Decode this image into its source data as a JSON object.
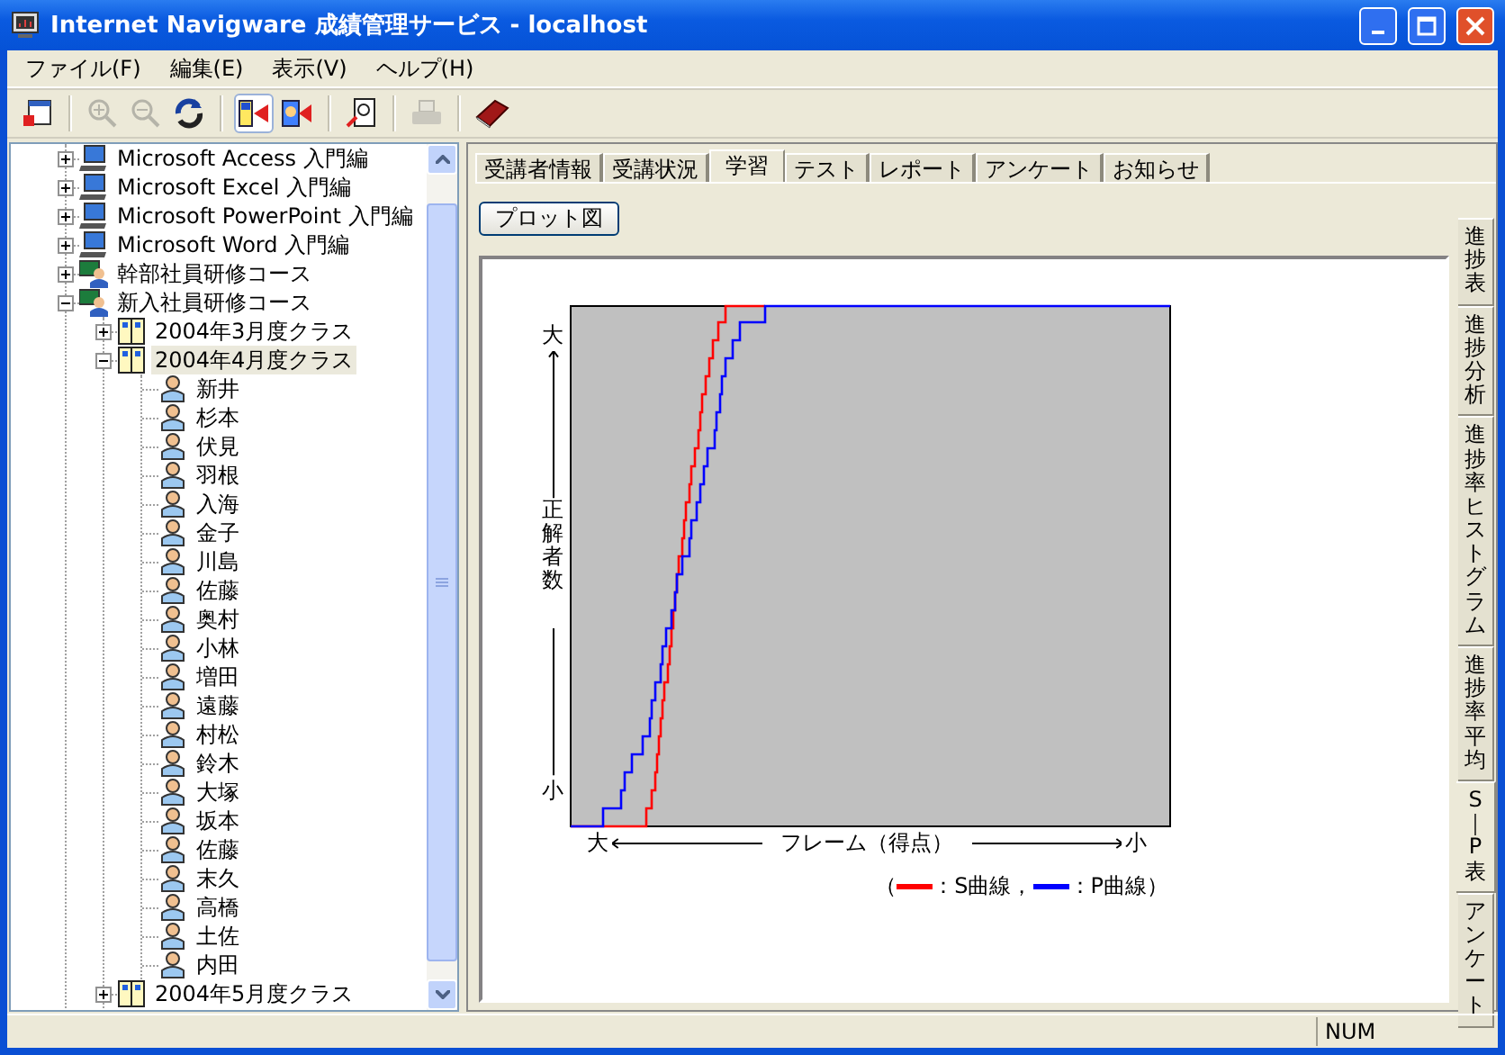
{
  "window": {
    "title": "Internet Navigware 成績管理サービス - localhost"
  },
  "menu": [
    "ファイル(F)",
    "編集(E)",
    "表示(V)",
    "ヘルプ(H)"
  ],
  "toolbar": [
    {
      "kind": "window",
      "disabled": false,
      "pressed": false
    },
    {
      "kind": "separator"
    },
    {
      "kind": "zoom-in",
      "disabled": true,
      "pressed": false
    },
    {
      "kind": "zoom-out",
      "disabled": true,
      "pressed": false
    },
    {
      "kind": "refresh",
      "disabled": false,
      "pressed": false
    },
    {
      "kind": "separator"
    },
    {
      "kind": "panel-left",
      "disabled": false,
      "pressed": true
    },
    {
      "kind": "panel-right",
      "disabled": false,
      "pressed": false
    },
    {
      "kind": "separator"
    },
    {
      "kind": "report",
      "disabled": false,
      "pressed": false
    },
    {
      "kind": "separator"
    },
    {
      "kind": "printer",
      "disabled": true,
      "pressed": false
    },
    {
      "kind": "separator"
    },
    {
      "kind": "book",
      "disabled": false,
      "pressed": false
    }
  ],
  "tree": [
    {
      "kind": "computer",
      "label": "Microsoft Access 入門編",
      "expanded": false,
      "selected": false
    },
    {
      "kind": "computer",
      "label": "Microsoft Excel 入門編",
      "expanded": false,
      "selected": false
    },
    {
      "kind": "computer",
      "label": "Microsoft PowerPoint 入門編",
      "expanded": false,
      "selected": false
    },
    {
      "kind": "computer",
      "label": "Microsoft Word 入門編",
      "expanded": false,
      "selected": false
    },
    {
      "kind": "course",
      "label": "幹部社員研修コース",
      "expanded": false,
      "selected": false
    },
    {
      "kind": "course",
      "label": "新入社員研修コース",
      "expanded": true,
      "selected": false,
      "children": [
        {
          "kind": "class",
          "label": "2004年3月度クラス",
          "expanded": false,
          "selected": false
        },
        {
          "kind": "class",
          "label": "2004年4月度クラス",
          "expanded": true,
          "selected": true,
          "children": [
            {
              "kind": "person",
              "label": "新井",
              "selected": false
            },
            {
              "kind": "person",
              "label": "杉本",
              "selected": false
            },
            {
              "kind": "person",
              "label": "伏見",
              "selected": false
            },
            {
              "kind": "person",
              "label": "羽根",
              "selected": false
            },
            {
              "kind": "person",
              "label": "入海",
              "selected": false
            },
            {
              "kind": "person",
              "label": "金子",
              "selected": false
            },
            {
              "kind": "person",
              "label": "川島",
              "selected": false
            },
            {
              "kind": "person",
              "label": "佐藤",
              "selected": false
            },
            {
              "kind": "person",
              "label": "奥村",
              "selected": false
            },
            {
              "kind": "person",
              "label": "小林",
              "selected": false
            },
            {
              "kind": "person",
              "label": "増田",
              "selected": false
            },
            {
              "kind": "person",
              "label": "遠藤",
              "selected": false
            },
            {
              "kind": "person",
              "label": "村松",
              "selected": false
            },
            {
              "kind": "person",
              "label": "鈴木",
              "selected": false
            },
            {
              "kind": "person",
              "label": "大塚",
              "selected": false
            },
            {
              "kind": "person",
              "label": "坂本",
              "selected": false
            },
            {
              "kind": "person",
              "label": "佐藤",
              "selected": false
            },
            {
              "kind": "person",
              "label": "末久",
              "selected": false
            },
            {
              "kind": "person",
              "label": "高橋",
              "selected": false
            },
            {
              "kind": "person",
              "label": "土佐",
              "selected": false
            },
            {
              "kind": "person",
              "label": "内田",
              "selected": false
            }
          ]
        },
        {
          "kind": "class",
          "label": "2004年5月度クラス",
          "expanded": false,
          "selected": false
        }
      ]
    }
  ],
  "tabs": [
    {
      "label": "受講者情報",
      "selected": false
    },
    {
      "label": "受講状況",
      "selected": false
    },
    {
      "label": "学習",
      "selected": true
    },
    {
      "label": "テスト",
      "selected": false
    },
    {
      "label": "レポート",
      "selected": false
    },
    {
      "label": "アンケート",
      "selected": false
    },
    {
      "label": "お知らせ",
      "selected": false
    }
  ],
  "plot_button": "プロット図",
  "chart": {
    "y_top": "大",
    "y_label": "正解者数",
    "y_bottom": "小",
    "x_left": "大",
    "x_label": "フレーム（得点）",
    "x_right": "小",
    "legend": {
      "open": "（",
      "close": "）",
      "items": [
        {
          "label": "：S曲線，",
          "color": "#ff0000"
        },
        {
          "label": "：P曲線",
          "color": "#0000ff"
        }
      ]
    }
  },
  "side_tabs": [
    {
      "label": "進捗表",
      "selected": false
    },
    {
      "label": "進捗分析",
      "selected": false
    },
    {
      "label": "進捗率ヒストグラム",
      "selected": false
    },
    {
      "label": "進捗率平均",
      "selected": false
    },
    {
      "label": "S｜P表",
      "selected": true
    },
    {
      "label": "アンケート",
      "selected": false
    }
  ],
  "status_bar": [
    "NUM"
  ]
}
